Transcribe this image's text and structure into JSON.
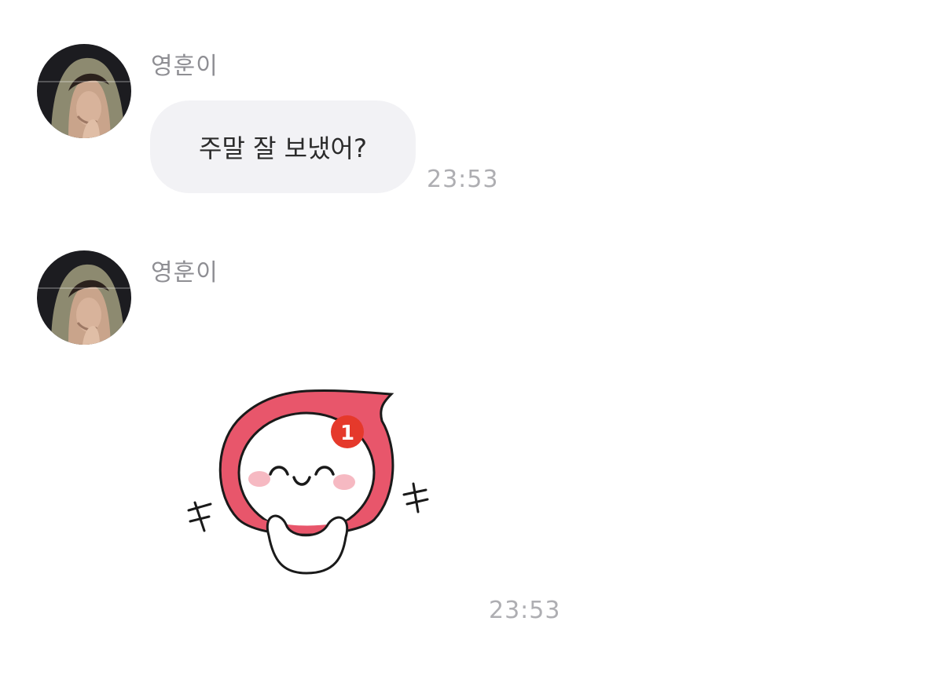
{
  "messages": [
    {
      "sender": "영훈이",
      "text": "주말 잘 보냈어?",
      "time": "23:53"
    },
    {
      "sender": "영훈이",
      "sticker": {
        "badge": "1",
        "icon": "smiling-speech-bubble-character"
      },
      "time": "23:53"
    }
  ],
  "colors": {
    "bubble_bg": "#f2f2f5",
    "sticker_red": "#e8566b",
    "badge_red": "#e5392b",
    "name_gray": "#8e8e93",
    "time_gray": "#aeaeb2"
  }
}
